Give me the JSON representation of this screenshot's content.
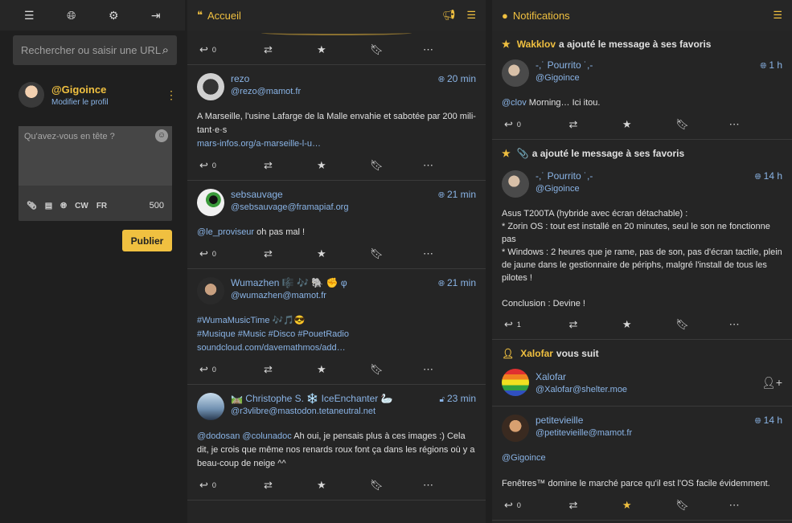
{
  "nav": {
    "icons": [
      "menu-icon",
      "globe-icon",
      "gear-icon",
      "logout-icon"
    ]
  },
  "search": {
    "placeholder": "Rechercher ou saisir une URL"
  },
  "profile": {
    "handle": "@Gigoince",
    "edit_label": "Modifier le profil"
  },
  "composer": {
    "placeholder": "Qu'avez-vous en tête ?",
    "cw_label": "CW",
    "lang_label": "FR",
    "char_count": "500",
    "publish_label": "Publier"
  },
  "home": {
    "title": "Accueil",
    "first_reply_count": "0",
    "statuses": [
      {
        "display_name": "rezo",
        "acct": "@rezo@mamot.fr",
        "time": "20 min",
        "text": "A Marseille, l'usine Lafarge de la Malle envahie et sabotée par 200 mili-tant·e·s",
        "link": "mars-infos.org/a-marseille-l-u…",
        "replies": "0"
      },
      {
        "display_name": "sebsauvage",
        "acct": "@sebsauvage@framapiaf.org",
        "time": "21 min",
        "mention": "@le_proviseur",
        "text": " oh pas mal !",
        "replies": "0"
      },
      {
        "display_name": "Wumazhen 🎼 🎶 🐘 ✊ φ",
        "acct": "@wumazhen@mamot.fr",
        "time": "21 min",
        "tags_line1": "#WumaMusicTime 🎶🎵😎",
        "tags_line2": "#Musique #Music #Disco #PouetRadio",
        "link": "soundcloud.com/davemathmos/add…",
        "replies": "0"
      },
      {
        "display_name": "🛤️ Christophe S. ❄️ IceEnchanter 🦢",
        "acct": "@r3vlibre@mastodon.tetaneutral.net",
        "time": "23 min",
        "mention": "@dodosan @colunadoc",
        "text": " Ah oui, je pensais plus à ces images :) Cela dit, je crois que même nos renards roux font ça dans les régions où y a beau-coup de neige ^^",
        "replies": "0"
      }
    ]
  },
  "notifications": {
    "title": "Notifications",
    "items": [
      {
        "who": "Wakklov",
        "action": "a ajouté le message à ses favoris",
        "display_name": "-,˙ Pourrito ˙,-",
        "acct": "@Gigoince",
        "time": "1 h",
        "mention": "@clov",
        "text": " Morning… Ici itou.",
        "replies": "0"
      },
      {
        "who": "📎",
        "action": "a ajouté le message à ses favoris",
        "display_name": "-,˙ Pourrito ˙,-",
        "acct": "@Gigoince",
        "time": "14 h",
        "lines": [
          "Asus T200TA (hybride avec écran détachable) :",
          "* Zorin OS : tout est installé en 20 minutes, seul le son ne fonctionne pas",
          "* Windows : 2 heures que je rame, pas de son, pas d'écran tactile, plein de jaune dans le gestionnaire de périphs, malgré l'install de tous les pilotes !",
          "",
          "Conclusion : Devine !"
        ],
        "replies": "1"
      },
      {
        "who": "Xalofar",
        "action": "vous suit",
        "display_name": "Xalofar",
        "acct": "@Xalofar@shelter.moe"
      },
      {
        "display_name": "petitevieille",
        "acct": "@petitevieille@mamot.fr",
        "time": "14 h",
        "mention": "@Gigoince",
        "text": "Fenêtres™ domine le marché parce qu'il est l'OS facile évidemment.",
        "replies": "0"
      }
    ]
  }
}
